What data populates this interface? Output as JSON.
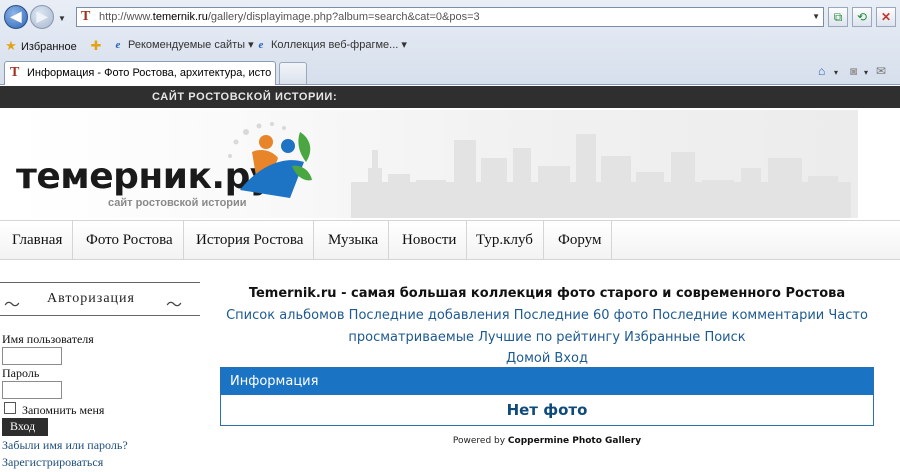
{
  "browser": {
    "address_url_prefix": "http://www.",
    "address_url_domain": "temernik.ru",
    "address_url_path": "/gallery/displayimage.php?album=search&cat=0&pos=3",
    "favorites_label": "Избранное",
    "fav_items": [
      "Рекомендуемые сайты",
      "Коллекция веб-фрагме..."
    ],
    "tab_title": "Информация - Фото Ростова, архитектура, истори..."
  },
  "site": {
    "top_strip": "САЙТ РОСТОВСКОЙ ИСТОРИИ:",
    "logo_title": "темерник.ру",
    "logo_subtitle": "сайт ростовской истории",
    "menu": [
      "Главная",
      "Фото Ростова",
      "История Ростова",
      "Музыка",
      "Новости",
      "Тур.клуб",
      "Форум"
    ]
  },
  "sidebar": {
    "heading": "Авторизация",
    "username_label": "Имя пользователя",
    "password_label": "Пароль",
    "remember_label": "Запомнить меня",
    "login_button": "Вход",
    "forgot_link": "Забыли имя или пароль?",
    "register_link": "Зарегистрироваться"
  },
  "main": {
    "title": "Temernik.ru - самая большая коллекция фото старого и современного Ростова",
    "links_line1": "Список альбомов Последние добавления Последние 60 фото Последние комментарии Часто",
    "links_line2": "просматриваемые Лучшие по рейтингу Избранные Поиск",
    "links_line3": "Домой Вход",
    "info_header": "Информация",
    "info_body": "Нет фото",
    "powered_prefix": "Powered by ",
    "powered_name": "Coppermine Photo Gallery"
  },
  "colors": {
    "accent": "#1a74c3",
    "link": "#1e5a90",
    "topstrip": "#2f2f2f"
  }
}
